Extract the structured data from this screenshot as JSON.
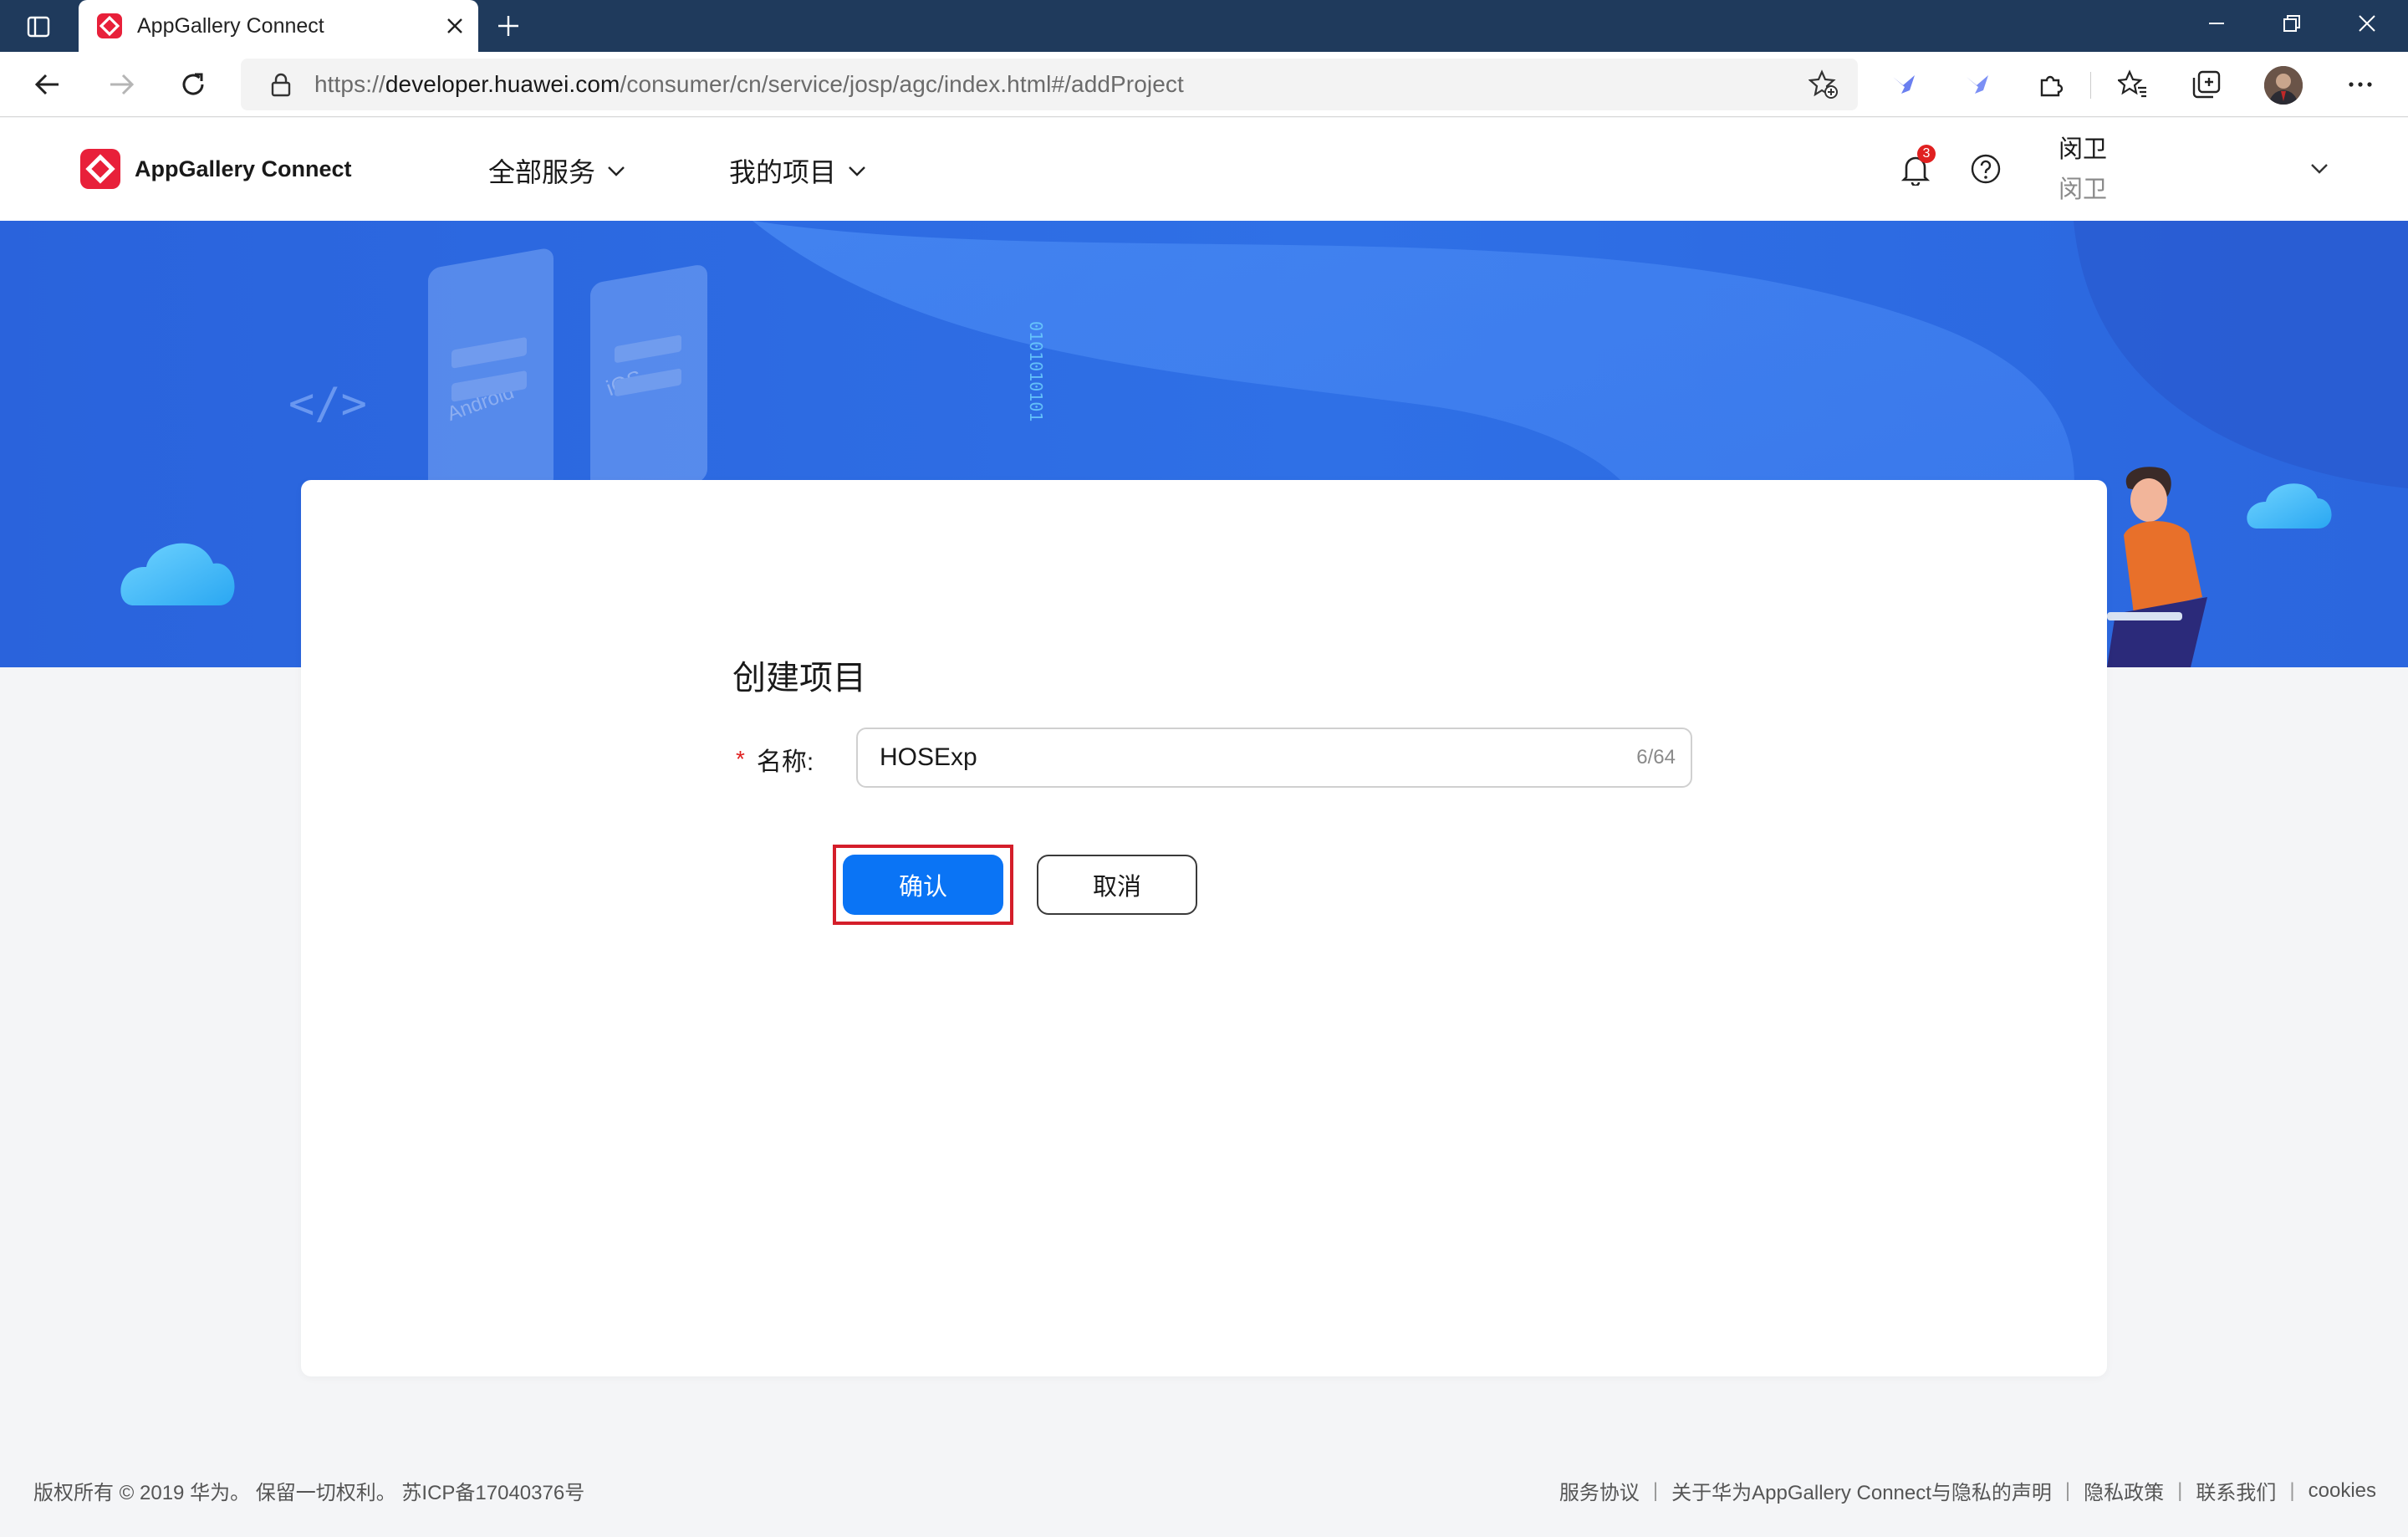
{
  "browser": {
    "tab_title": "AppGallery Connect",
    "url_prefix": "https://",
    "url_host": "developer.huawei.com",
    "url_path": "/consumer/cn/service/josp/agc/index.html#/addProject"
  },
  "header": {
    "brand": "AppGallery Connect",
    "nav": [
      "全部服务",
      "我的项目"
    ],
    "notification_count": "3",
    "user_name": "闵卫",
    "user_account": "闵卫"
  },
  "banner": {
    "android_label": "Android",
    "ios_label": "iOS",
    "code_label": "</>",
    "binary": "0101010101"
  },
  "form": {
    "title": "创建项目",
    "required_mark": "*",
    "name_label": "名称:",
    "name_value": "HOSExp",
    "name_counter": "6/64",
    "confirm_label": "确认",
    "cancel_label": "取消"
  },
  "footer": {
    "copyright": "版权所有 © 2019 华为。 保留一切权利。 苏ICP备17040376号",
    "links": [
      "服务协议",
      "关于华为AppGallery Connect与隐私的声明",
      "隐私政策",
      "联系我们",
      "cookies"
    ],
    "separator": "|"
  },
  "colors": {
    "title_bar": "#1f3a5c",
    "banner_blue": "#2f6fe0",
    "primary_button": "#0a74f5",
    "highlight_frame": "#d41e2a",
    "badge": "#e02020",
    "brand_red": "#e8203a"
  }
}
